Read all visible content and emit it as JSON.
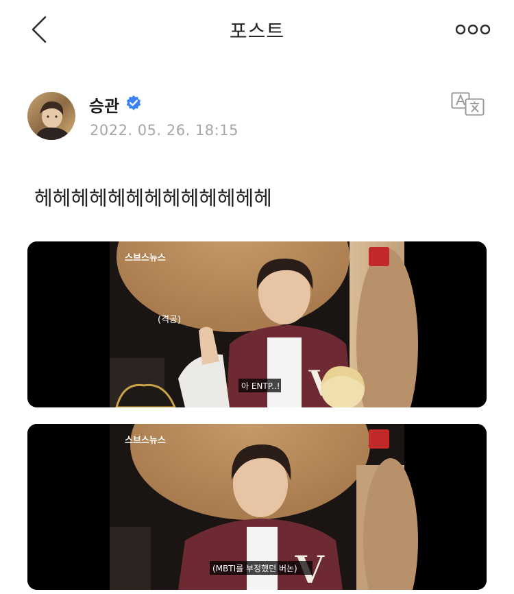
{
  "header": {
    "title": "포스트",
    "back_icon": "chevron-left-icon",
    "more_icon": "more-horizontal-icon"
  },
  "post": {
    "author": "승관",
    "verified": true,
    "timestamp": "2022. 05. 26. 18:15",
    "text": "헤헤헤헤헤헤헤헤헤헤헤헤헤",
    "translate_icon": "translate-icon"
  },
  "media": [
    {
      "kind": "video-still",
      "logo": "스브스뉴스",
      "caption_left": "(격공)",
      "subtitle": "아 ENTP..!"
    },
    {
      "kind": "video-still",
      "logo": "스브스뉴스",
      "subtitle": "(MBTI를 부정했던 버논)"
    }
  ],
  "colors": {
    "verified": "#3b82f6",
    "timestamp": "#a6a6a6",
    "jacket": "#6e2a33"
  }
}
